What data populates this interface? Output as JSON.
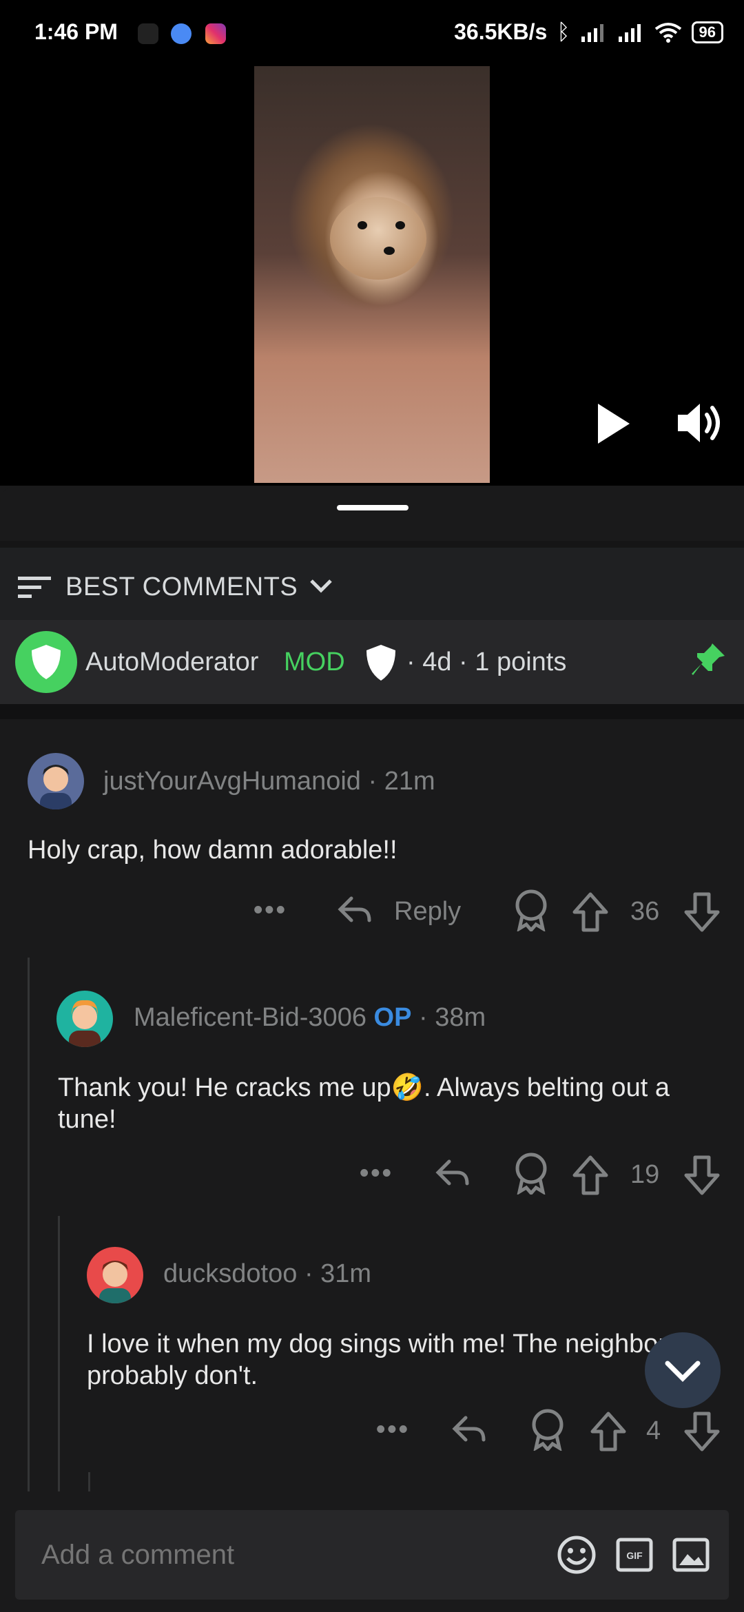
{
  "status_bar": {
    "time": "1:46 PM",
    "network_speed": "36.5KB/s",
    "battery": "96"
  },
  "video": {
    "controls": [
      "play-icon",
      "volume-icon"
    ]
  },
  "sort": {
    "label": "BEST COMMENTS"
  },
  "pinned": {
    "author": "AutoModerator",
    "tag": "MOD",
    "meta": "· 4d · 1 points"
  },
  "comments": [
    {
      "author": "justYourAvgHumanoid",
      "age": "· 21m",
      "body": "Holy crap, how damn adorable!!",
      "reply_label": "Reply",
      "score": "36"
    },
    {
      "author": "Maleficent-Bid-3006",
      "op_tag": "OP",
      "age": "· 38m",
      "body": "Thank you! He cracks me up🤣. Always belting out a tune!",
      "score": "19"
    },
    {
      "author": "ducksdotoo",
      "age": "· 31m",
      "body": "I love it when my dog sings with me! The neighbors probably don't.",
      "score": "4"
    }
  ],
  "composer": {
    "placeholder": "Add a comment"
  },
  "colors": {
    "mod_green": "#46d160",
    "op_blue": "#3a8be0",
    "background": "#1a1a1b"
  }
}
